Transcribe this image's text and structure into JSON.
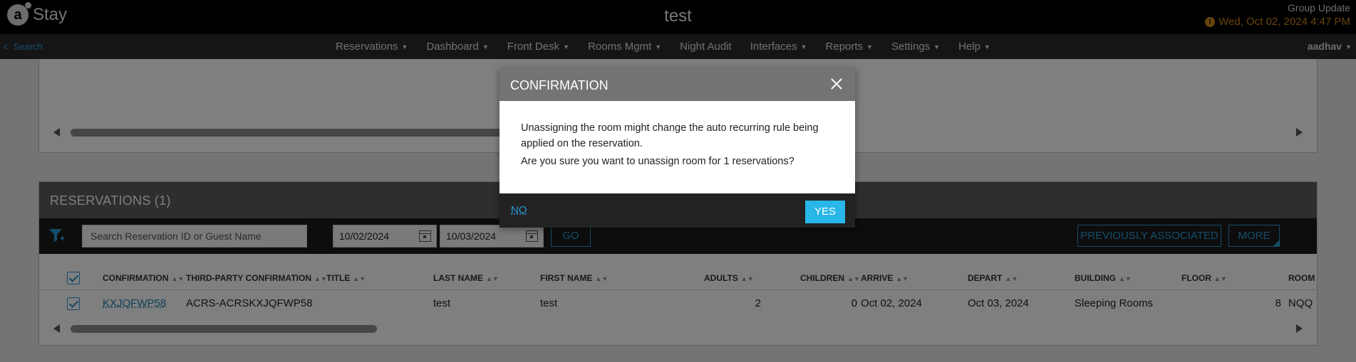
{
  "app": {
    "logo_text": "Stay",
    "title": "test",
    "group_update": "Group Update",
    "datetime": "Wed, Oct 02, 2024 4:47 PM",
    "user": "aadhav"
  },
  "nav": {
    "search": "Search",
    "items": [
      "Reservations",
      "Dashboard",
      "Front Desk",
      "Rooms Mgmt",
      "Night Audit",
      "Interfaces",
      "Reports",
      "Settings",
      "Help"
    ]
  },
  "reservations": {
    "header": "RESERVATIONS (1)",
    "search_placeholder": "Search Reservation ID or Guest Name",
    "date_from": "10/02/2024",
    "date_to": "10/03/2024",
    "go_label": "GO",
    "previously_associated_label": "PREVIOUSLY ASSOCIATED",
    "more_label": "MORE",
    "columns": [
      "CONFIRMATION",
      "THIRD-PARTY CONFIRMATION",
      "TITLE",
      "LAST NAME",
      "FIRST NAME",
      "ADULTS",
      "CHILDREN",
      "ARRIVE",
      "DEPART",
      "BUILDING",
      "FLOOR",
      "ROOM"
    ],
    "rows": [
      {
        "confirmation": "KXJQFWP58",
        "third_party": "ACRS-ACRSKXJQFWP58",
        "title": "",
        "last_name": "test",
        "first_name": "test",
        "adults": "2",
        "children": "0",
        "arrive": "Oct 02, 2024",
        "depart": "Oct 03, 2024",
        "building": "Sleeping Rooms",
        "floor": "8",
        "room": "NQQ"
      }
    ]
  },
  "modal": {
    "title": "CONFIRMATION",
    "line1": "Unassigning the room might change the auto recurring rule being applied on the reservation.",
    "line2": "Are you sure you want to unassign room for 1 reservations?",
    "no_label": "NO",
    "yes_label": "YES"
  },
  "colors": {
    "accent": "#2a9bd6",
    "yes_button": "#29b6e8",
    "warning": "#d08a1a"
  }
}
